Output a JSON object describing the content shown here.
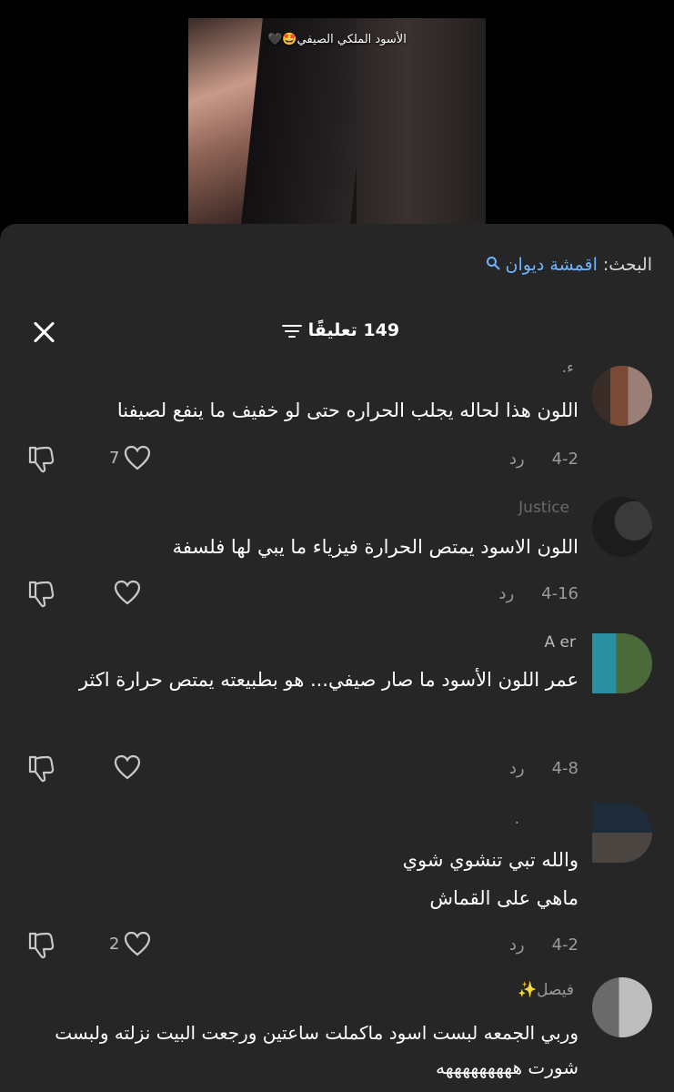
{
  "video": {
    "caption": "الأسود الملكي الصيفي🤩🖤"
  },
  "search": {
    "label": "البحث:",
    "term": "اقمشة ديوان"
  },
  "header": {
    "count_label": "149 تعليقًا"
  },
  "comments": [
    {
      "username": "ء.",
      "text": "اللون هذا لحاله يجلب الحراره حتى لو خفيف ما ينفع لصيفنا",
      "date": "4-2",
      "reply": "رد",
      "likes": "7"
    },
    {
      "username": "Justice",
      "text": "اللون الاسود يمتص الحرارة فيزياء ما يبي لها فلسفة",
      "date": "4-16",
      "reply": "رد",
      "likes": ""
    },
    {
      "username": "A        er",
      "text": "عمر اللون الأسود ما صار صيفي... هو بطبيعته يمتص حرارة اكثر",
      "date": "4-8",
      "reply": "رد",
      "likes": ""
    },
    {
      "username": ".",
      "text_line1": "والله تبي تنشوي شوي",
      "text_line2": "ماهي على القماش",
      "date": "4-2",
      "reply": "رد",
      "likes": "2"
    },
    {
      "username": "فيصل✨",
      "text": "وربي الجمعه لبست اسود ماكملت ساعتين ورجعت البيت نزلته ولبست شورت هههههههههه"
    }
  ],
  "colors": {
    "accent": "#6fb4ff",
    "sheet": "#262626",
    "muted": "#9a9a9a"
  }
}
